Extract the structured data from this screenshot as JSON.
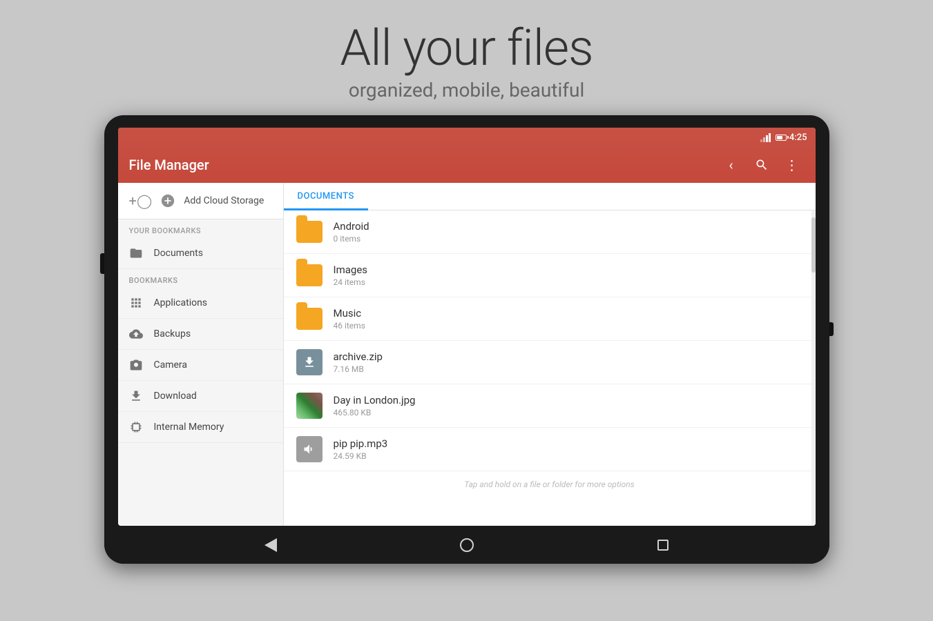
{
  "page": {
    "headline": "All your files",
    "subheadline": "organized, mobile, beautiful"
  },
  "status_bar": {
    "time": "4:25"
  },
  "toolbar": {
    "title": "File Manager"
  },
  "sidebar": {
    "add_cloud_label": "Add Cloud Storage",
    "your_bookmarks_label": "YOUR BOOKMARKS",
    "bookmarks_label": "BOOKMARKS",
    "bookmarks_items": [
      {
        "id": "documents",
        "label": "Documents",
        "icon": "folder"
      }
    ],
    "items": [
      {
        "id": "applications",
        "label": "Applications",
        "icon": "grid"
      },
      {
        "id": "backups",
        "label": "Backups",
        "icon": "backup"
      },
      {
        "id": "camera",
        "label": "Camera",
        "icon": "camera"
      },
      {
        "id": "download",
        "label": "Download",
        "icon": "download"
      },
      {
        "id": "internal-memory",
        "label": "Internal Memory",
        "icon": "memory"
      }
    ]
  },
  "file_panel": {
    "tab": "DOCUMENTS",
    "files": [
      {
        "id": "android",
        "name": "Android",
        "meta": "0 items",
        "type": "folder"
      },
      {
        "id": "images",
        "name": "Images",
        "meta": "24 items",
        "type": "folder"
      },
      {
        "id": "music",
        "name": "Music",
        "meta": "46 items",
        "type": "folder"
      },
      {
        "id": "archive",
        "name": "archive.zip",
        "meta": "7.16 MB",
        "type": "zip"
      },
      {
        "id": "london",
        "name": "Day in London.jpg",
        "meta": "465.80 KB",
        "type": "image"
      },
      {
        "id": "pip",
        "name": "pip pip.mp3",
        "meta": "24.59 KB",
        "type": "audio"
      }
    ],
    "footer_hint": "Tap and hold on a file or folder for more options"
  }
}
